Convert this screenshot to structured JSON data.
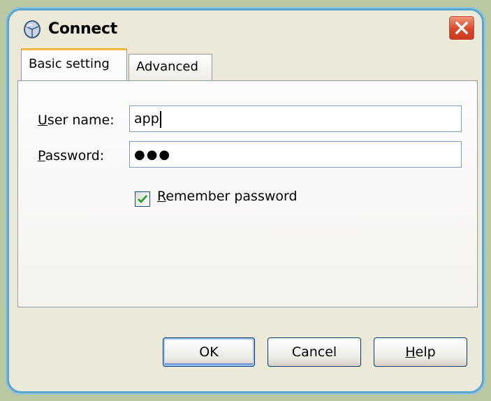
{
  "window": {
    "title": "Connect"
  },
  "tabs": [
    {
      "label": "Basic setting",
      "active": true
    },
    {
      "label": "Advanced",
      "active": false
    }
  ],
  "form": {
    "username_label": "User name:",
    "username_mnemonic": "U",
    "username_rest": "ser name:",
    "username_value": "app",
    "password_label": "Password:",
    "password_mnemonic": "P",
    "password_rest": "assword:",
    "password_mask": "●●●",
    "remember_mnemonic": "R",
    "remember_rest": "emember password",
    "remember_checked": true
  },
  "buttons": {
    "ok": "OK",
    "cancel": "Cancel",
    "help_mnemonic": "H",
    "help_rest": "elp"
  },
  "icons": {
    "app": "cube-icon",
    "close": "close-icon",
    "check": "checkmark-icon"
  },
  "colors": {
    "window_border": "#5aa6cf",
    "close_red": "#d9482a",
    "active_tab_accent": "#f5b73f",
    "check_green": "#21a121"
  }
}
